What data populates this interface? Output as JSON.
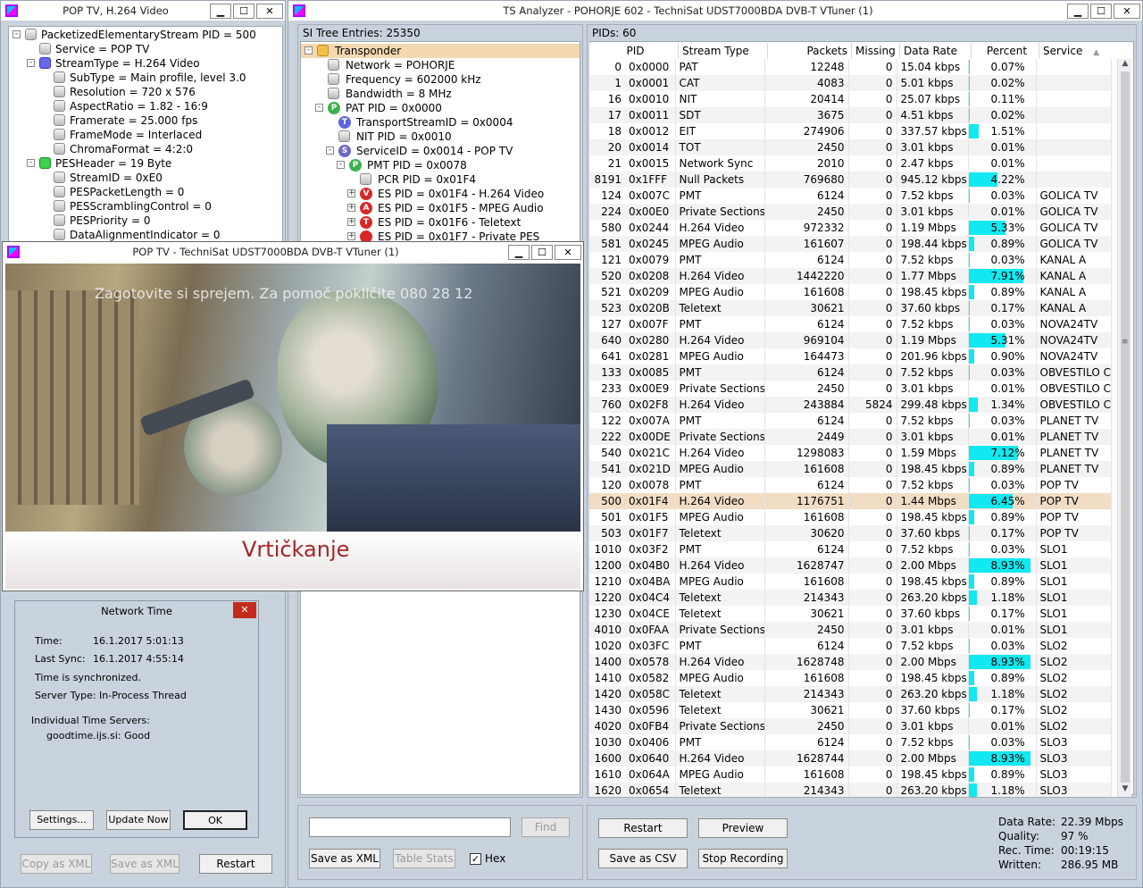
{
  "pes_window": {
    "title": "POP TV, H.264 Video",
    "tree": [
      {
        "label": "PacketizedElementaryStream PID = 500",
        "depth": 0,
        "exp": "-",
        "bullet": "g"
      },
      {
        "label": "Service = POP TV",
        "depth": 1,
        "exp": "",
        "bullet": "g"
      },
      {
        "label": "StreamType = H.264 Video",
        "depth": 1,
        "exp": "-",
        "bullet": "b"
      },
      {
        "label": "SubType = Main profile, level 3.0",
        "depth": 2,
        "exp": "",
        "bullet": "g"
      },
      {
        "label": "Resolution = 720 x 576",
        "depth": 2,
        "exp": "",
        "bullet": "g"
      },
      {
        "label": "AspectRatio = 1.82 - 16:9",
        "depth": 2,
        "exp": "",
        "bullet": "g"
      },
      {
        "label": "Framerate = 25.000 fps",
        "depth": 2,
        "exp": "",
        "bullet": "g"
      },
      {
        "label": "FrameMode = Interlaced",
        "depth": 2,
        "exp": "",
        "bullet": "g"
      },
      {
        "label": "ChromaFormat = 4:2:0",
        "depth": 2,
        "exp": "",
        "bullet": "g"
      },
      {
        "label": "PESHeader = 19 Byte",
        "depth": 1,
        "exp": "-",
        "bullet": "gr"
      },
      {
        "label": "StreamID = 0xE0",
        "depth": 2,
        "exp": "",
        "bullet": "g"
      },
      {
        "label": "PESPacketLength = 0",
        "depth": 2,
        "exp": "",
        "bullet": "g"
      },
      {
        "label": "PESScramblingControl = 0",
        "depth": 2,
        "exp": "",
        "bullet": "g"
      },
      {
        "label": "PESPriority = 0",
        "depth": 2,
        "exp": "",
        "bullet": "g"
      },
      {
        "label": "DataAlignmentIndicator = 0",
        "depth": 2,
        "exp": "",
        "bullet": "g"
      }
    ],
    "copy_xml": "Copy as XML",
    "save_xml": "Save as XML",
    "restart": "Restart"
  },
  "main_window": {
    "title": "TS Analyzer - POHORJE 602 - TechniSat UDST7000BDA DVB-T VTuner (1)"
  },
  "si_tree": {
    "header": "SI Tree Entries: 25350",
    "tree": [
      {
        "label": "Transponder",
        "depth": 0,
        "exp": "-",
        "icon": "y",
        "sel": true
      },
      {
        "label": "Network = POHORJE",
        "depth": 1,
        "exp": "",
        "icon": "g"
      },
      {
        "label": "Frequency = 602000 kHz",
        "depth": 1,
        "exp": "",
        "icon": "g"
      },
      {
        "label": "Bandwidth = 8 MHz",
        "depth": 1,
        "exp": "",
        "icon": "g"
      },
      {
        "label": "PAT PID = 0x0000",
        "depth": 1,
        "exp": "-",
        "icon": "P",
        "color": "#3bb24b"
      },
      {
        "label": "TransportStreamID = 0x0004",
        "depth": 2,
        "exp": "",
        "icon": "T",
        "color": "#5a68e0"
      },
      {
        "label": "NIT PID = 0x0010",
        "depth": 2,
        "exp": "",
        "icon": "g"
      },
      {
        "label": "ServiceID = 0x0014 - POP TV",
        "depth": 2,
        "exp": "-",
        "icon": "S",
        "color": "#6a68c8"
      },
      {
        "label": "PMT PID = 0x0078",
        "depth": 3,
        "exp": "-",
        "icon": "P",
        "color": "#3bb24b"
      },
      {
        "label": "PCR PID = 0x01F4",
        "depth": 4,
        "exp": "",
        "icon": "g"
      },
      {
        "label": "ES PID = 0x01F4 - H.264 Video",
        "depth": 4,
        "exp": "+",
        "icon": "V",
        "color": "#d82828"
      },
      {
        "label": "ES PID = 0x01F5 - MPEG Audio",
        "depth": 4,
        "exp": "+",
        "icon": "A",
        "color": "#d82828"
      },
      {
        "label": "ES PID = 0x01F6 - Teletext",
        "depth": 4,
        "exp": "+",
        "icon": "T",
        "color": "#d82828"
      },
      {
        "label": "ES PID = 0x01F7 - Private PES",
        "depth": 4,
        "exp": "+",
        "icon": "",
        "color": "#d82828"
      }
    ],
    "find_placeholder": "",
    "find": "Find",
    "save_xml": "Save as XML",
    "table_stats": "Table Stats",
    "hex": "Hex",
    "hex_checked": true
  },
  "video_window": {
    "title": "POP TV - TechniSat UDST7000BDA DVB-T VTuner (1)",
    "overlay_text": "Zagotovite si sprejem. Za pomoč pokličite 080 28 12",
    "show_title": "Vrtičkanje"
  },
  "network_time": {
    "title": "Network Time",
    "time_label": "Time:",
    "time_value": "16.1.2017 5:01:13",
    "last_sync_label": "Last Sync:",
    "last_sync_value": "16.1.2017 4:55:14",
    "status": "Time is synchronized.",
    "server_type": "Server Type: In-Process Thread",
    "servers_label": "Individual Time Servers:",
    "server": "goodtime.ijs.si: Good",
    "settings": "Settings...",
    "update_now": "Update Now",
    "ok": "OK"
  },
  "pids": {
    "header": "PIDs: 60",
    "columns": [
      "PID",
      "Stream Type",
      "Packets",
      "Missing",
      "Data Rate",
      "Percent",
      "Service"
    ],
    "rows": [
      [
        "0",
        "0x0000",
        "PAT",
        "12248",
        "0",
        "15.04 kbps",
        "0.07%",
        ""
      ],
      [
        "1",
        "0x0001",
        "CAT",
        "4083",
        "0",
        "5.01 kbps",
        "0.02%",
        ""
      ],
      [
        "16",
        "0x0010",
        "NIT",
        "20414",
        "0",
        "25.07 kbps",
        "0.11%",
        ""
      ],
      [
        "17",
        "0x0011",
        "SDT",
        "3675",
        "0",
        "4.51 kbps",
        "0.02%",
        ""
      ],
      [
        "18",
        "0x0012",
        "EIT",
        "274906",
        "0",
        "337.57 kbps",
        "1.51%",
        ""
      ],
      [
        "20",
        "0x0014",
        "TOT",
        "2450",
        "0",
        "3.01 kbps",
        "0.01%",
        ""
      ],
      [
        "21",
        "0x0015",
        "Network Sync",
        "2010",
        "0",
        "2.47 kbps",
        "0.01%",
        ""
      ],
      [
        "8191",
        "0x1FFF",
        "Null Packets",
        "769680",
        "0",
        "945.12 kbps",
        "4.22%",
        ""
      ],
      [
        "124",
        "0x007C",
        "PMT",
        "6124",
        "0",
        "7.52 kbps",
        "0.03%",
        "GOLICA TV"
      ],
      [
        "224",
        "0x00E0",
        "Private Sections",
        "2450",
        "0",
        "3.01 kbps",
        "0.01%",
        "GOLICA TV"
      ],
      [
        "580",
        "0x0244",
        "H.264 Video",
        "972332",
        "0",
        "1.19 Mbps",
        "5.33%",
        "GOLICA TV"
      ],
      [
        "581",
        "0x0245",
        "MPEG Audio",
        "161607",
        "0",
        "198.44 kbps",
        "0.89%",
        "GOLICA TV"
      ],
      [
        "121",
        "0x0079",
        "PMT",
        "6124",
        "0",
        "7.52 kbps",
        "0.03%",
        "KANAL A"
      ],
      [
        "520",
        "0x0208",
        "H.264 Video",
        "1442220",
        "0",
        "1.77 Mbps",
        "7.91%",
        "KANAL A"
      ],
      [
        "521",
        "0x0209",
        "MPEG Audio",
        "161608",
        "0",
        "198.45 kbps",
        "0.89%",
        "KANAL A"
      ],
      [
        "523",
        "0x020B",
        "Teletext",
        "30621",
        "0",
        "37.60 kbps",
        "0.17%",
        "KANAL A"
      ],
      [
        "127",
        "0x007F",
        "PMT",
        "6124",
        "0",
        "7.52 kbps",
        "0.03%",
        "NOVA24TV"
      ],
      [
        "640",
        "0x0280",
        "H.264 Video",
        "969104",
        "0",
        "1.19 Mbps",
        "5.31%",
        "NOVA24TV"
      ],
      [
        "641",
        "0x0281",
        "MPEG Audio",
        "164473",
        "0",
        "201.96 kbps",
        "0.90%",
        "NOVA24TV"
      ],
      [
        "133",
        "0x0085",
        "PMT",
        "6124",
        "0",
        "7.52 kbps",
        "0.03%",
        "OBVESTILO C"
      ],
      [
        "233",
        "0x00E9",
        "Private Sections",
        "2450",
        "0",
        "3.01 kbps",
        "0.01%",
        "OBVESTILO C"
      ],
      [
        "760",
        "0x02F8",
        "H.264 Video",
        "243884",
        "5824",
        "299.48 kbps",
        "1.34%",
        "OBVESTILO C"
      ],
      [
        "122",
        "0x007A",
        "PMT",
        "6124",
        "0",
        "7.52 kbps",
        "0.03%",
        "PLANET TV"
      ],
      [
        "222",
        "0x00DE",
        "Private Sections",
        "2449",
        "0",
        "3.01 kbps",
        "0.01%",
        "PLANET TV"
      ],
      [
        "540",
        "0x021C",
        "H.264 Video",
        "1298083",
        "0",
        "1.59 Mbps",
        "7.12%",
        "PLANET TV"
      ],
      [
        "541",
        "0x021D",
        "MPEG Audio",
        "161608",
        "0",
        "198.45 kbps",
        "0.89%",
        "PLANET TV"
      ],
      [
        "120",
        "0x0078",
        "PMT",
        "6124",
        "0",
        "7.52 kbps",
        "0.03%",
        "POP TV"
      ],
      [
        "500",
        "0x01F4",
        "H.264 Video",
        "1176751",
        "0",
        "1.44 Mbps",
        "6.45%",
        "POP TV"
      ],
      [
        "501",
        "0x01F5",
        "MPEG Audio",
        "161608",
        "0",
        "198.45 kbps",
        "0.89%",
        "POP TV"
      ],
      [
        "503",
        "0x01F7",
        "Teletext",
        "30620",
        "0",
        "37.60 kbps",
        "0.17%",
        "POP TV"
      ],
      [
        "1010",
        "0x03F2",
        "PMT",
        "6124",
        "0",
        "7.52 kbps",
        "0.03%",
        "SLO1"
      ],
      [
        "1200",
        "0x04B0",
        "H.264 Video",
        "1628747",
        "0",
        "2.00 Mbps",
        "8.93%",
        "SLO1"
      ],
      [
        "1210",
        "0x04BA",
        "MPEG Audio",
        "161608",
        "0",
        "198.45 kbps",
        "0.89%",
        "SLO1"
      ],
      [
        "1220",
        "0x04C4",
        "Teletext",
        "214343",
        "0",
        "263.20 kbps",
        "1.18%",
        "SLO1"
      ],
      [
        "1230",
        "0x04CE",
        "Teletext",
        "30621",
        "0",
        "37.60 kbps",
        "0.17%",
        "SLO1"
      ],
      [
        "4010",
        "0x0FAA",
        "Private Sections",
        "2450",
        "0",
        "3.01 kbps",
        "0.01%",
        "SLO1"
      ],
      [
        "1020",
        "0x03FC",
        "PMT",
        "6124",
        "0",
        "7.52 kbps",
        "0.03%",
        "SLO2"
      ],
      [
        "1400",
        "0x0578",
        "H.264 Video",
        "1628748",
        "0",
        "2.00 Mbps",
        "8.93%",
        "SLO2"
      ],
      [
        "1410",
        "0x0582",
        "MPEG Audio",
        "161608",
        "0",
        "198.45 kbps",
        "0.89%",
        "SLO2"
      ],
      [
        "1420",
        "0x058C",
        "Teletext",
        "214343",
        "0",
        "263.20 kbps",
        "1.18%",
        "SLO2"
      ],
      [
        "1430",
        "0x0596",
        "Teletext",
        "30621",
        "0",
        "37.60 kbps",
        "0.17%",
        "SLO2"
      ],
      [
        "4020",
        "0x0FB4",
        "Private Sections",
        "2450",
        "0",
        "3.01 kbps",
        "0.01%",
        "SLO2"
      ],
      [
        "1030",
        "0x0406",
        "PMT",
        "6124",
        "0",
        "7.52 kbps",
        "0.03%",
        "SLO3"
      ],
      [
        "1600",
        "0x0640",
        "H.264 Video",
        "1628744",
        "0",
        "2.00 Mbps",
        "8.93%",
        "SLO3"
      ],
      [
        "1610",
        "0x064A",
        "MPEG Audio",
        "161608",
        "0",
        "198.45 kbps",
        "0.89%",
        "SLO3"
      ],
      [
        "1620",
        "0x0654",
        "Teletext",
        "214343",
        "0",
        "263.20 kbps",
        "1.18%",
        "SLO3"
      ]
    ],
    "selected_pid": "500",
    "restart": "Restart",
    "preview": "Preview",
    "save_csv": "Save as CSV",
    "stop_recording": "Stop Recording"
  },
  "stats": {
    "data_rate_label": "Data Rate:",
    "data_rate": "22.39 Mbps",
    "quality_label": "Quality:",
    "quality": "97 %",
    "rec_time_label": "Rec. Time:",
    "rec_time": "00:19:15",
    "written_label": "Written:",
    "written": "286.95 MB"
  },
  "colors": {
    "percent_bar": "#12e8f0",
    "selected_row": "#f0ddc4",
    "tree_selected": "#f5d8b0",
    "close_red": "#c42b1c"
  }
}
